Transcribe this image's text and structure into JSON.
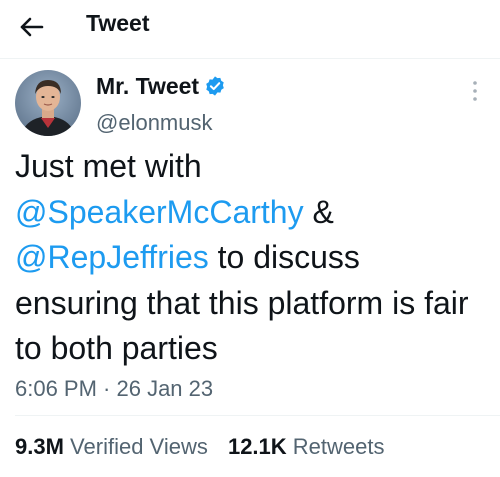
{
  "header": {
    "title": "Tweet",
    "back_icon": "arrow-left-icon"
  },
  "author": {
    "display_name": "Mr. Tweet",
    "handle": "@elonmusk",
    "verified_icon": "verified-badge-icon",
    "verified_color": "#1d9bf0"
  },
  "tweet": {
    "text_1": "Just met with ",
    "mention_1": "@SpeakerMcCarthy",
    "text_2": " & ",
    "mention_2": "@RepJeffries",
    "text_3": " to discuss ensuring that this platform is fair to both parties",
    "mention_color": "#1d9bf0"
  },
  "meta": {
    "timestamp": "6:06 PM · 26 Jan 23"
  },
  "stats": {
    "views_count": "9.3M",
    "views_label": "Verified Views",
    "retweets_count": "12.1K",
    "retweets_label": "Retweets"
  },
  "icons": {
    "more": "more-vertical-icon",
    "avatar": "avatar"
  }
}
